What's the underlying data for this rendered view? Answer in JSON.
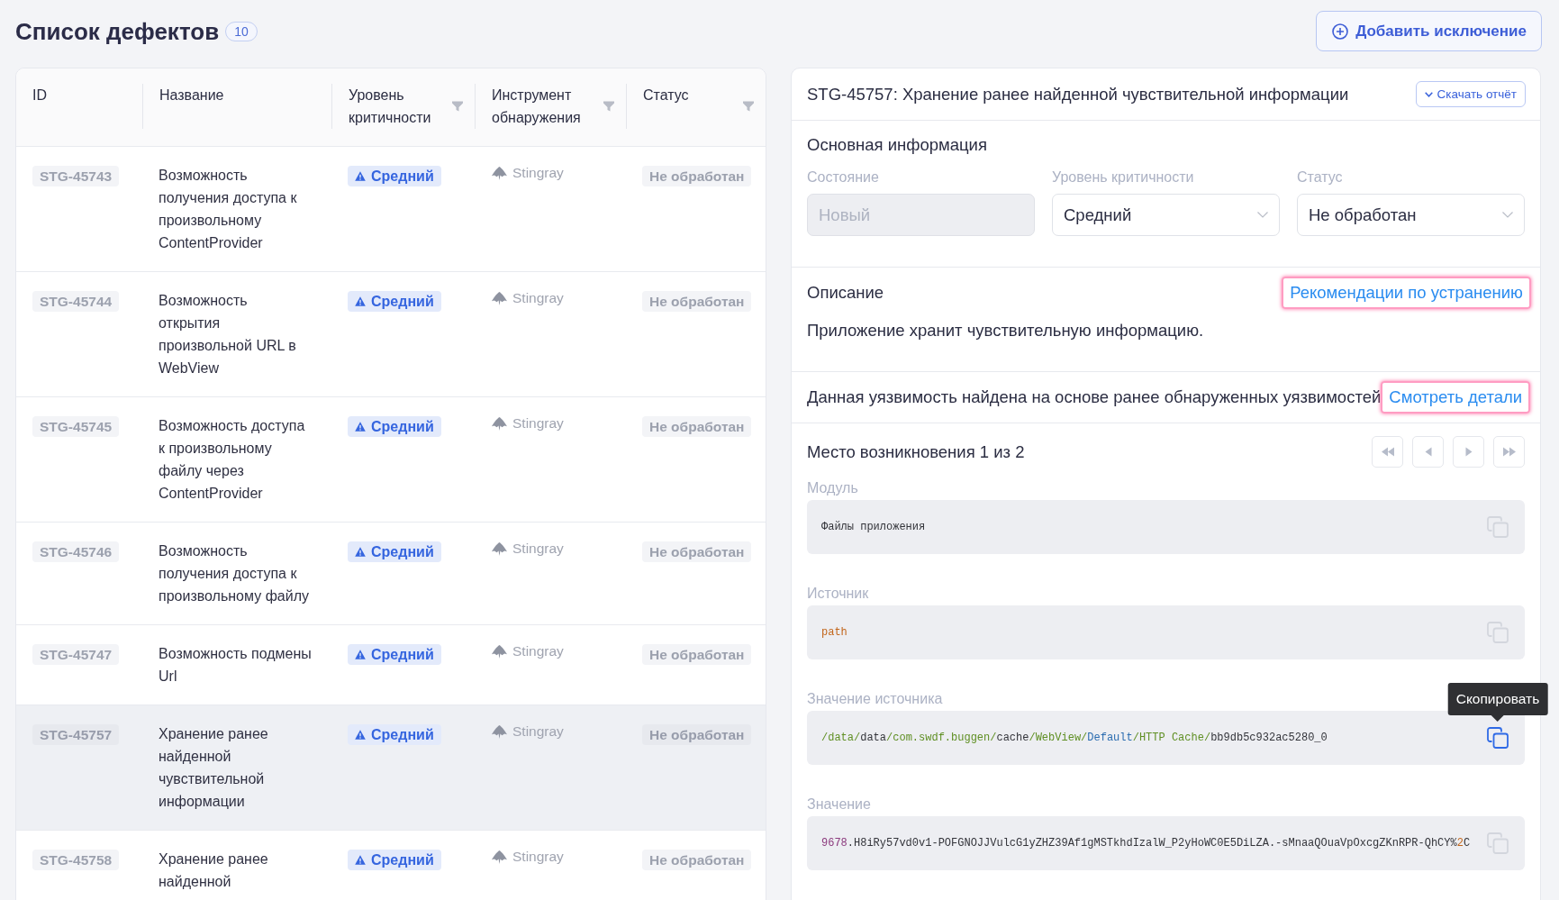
{
  "header": {
    "title": "Список дефектов",
    "count": "10",
    "add_button": "Добавить исключение"
  },
  "table": {
    "columns": [
      {
        "label": "ID",
        "filter": false
      },
      {
        "label": "Название",
        "filter": false
      },
      {
        "label": "Уровень критичности",
        "filter": true
      },
      {
        "label": "Инструмент обнаружения",
        "filter": true
      },
      {
        "label": "Статус",
        "filter": true
      }
    ],
    "rows": [
      {
        "id": "STG-45743",
        "name": "Возможность получения доступа к произвольному ContentProvider",
        "severity": "Средний",
        "tool": "Stingray",
        "status": "Не обработан",
        "selected": false
      },
      {
        "id": "STG-45744",
        "name": "Возможность открытия произвольной URL в WebView",
        "severity": "Средний",
        "tool": "Stingray",
        "status": "Не обработан",
        "selected": false
      },
      {
        "id": "STG-45745",
        "name": "Возможность доступа к произвольному файлу через ContentProvider",
        "severity": "Средний",
        "tool": "Stingray",
        "status": "Не обработан",
        "selected": false
      },
      {
        "id": "STG-45746",
        "name": "Возможность получения доступа к произвольному файлу",
        "severity": "Средний",
        "tool": "Stingray",
        "status": "Не обработан",
        "selected": false
      },
      {
        "id": "STG-45747",
        "name": "Возможность подмены Url",
        "severity": "Средний",
        "tool": "Stingray",
        "status": "Не обработан",
        "selected": false
      },
      {
        "id": "STG-45757",
        "name": "Хранение ранее найденной чувствительной информации",
        "severity": "Средний",
        "tool": "Stingray",
        "status": "Не обработан",
        "selected": true
      },
      {
        "id": "STG-45758",
        "name": "Хранение ранее найденной",
        "severity": "Средний",
        "tool": "Stingray",
        "status": "Не обработан",
        "selected": false
      }
    ]
  },
  "detail": {
    "title": "STG-45757: Хранение ранее найденной чувствительной информации",
    "download_button": "Скачать отчёт",
    "basic": {
      "heading": "Основная информация",
      "fields": [
        {
          "label": "Состояние",
          "value": "Новый",
          "kind": "readonly"
        },
        {
          "label": "Уровень критичности",
          "value": "Средний",
          "kind": "select"
        },
        {
          "label": "Статус",
          "value": "Не обработан",
          "kind": "select"
        }
      ]
    },
    "description": {
      "heading": "Описание",
      "link": {
        "text": "Рекомендации по устранению",
        "highlighted": true
      },
      "text": "Приложение хранит чувствительную информацию."
    },
    "origin_note": {
      "text": "Данная уязвимость найдена на основе ранее обнаруженных уязвимостей",
      "link": {
        "text": "Смотреть детали",
        "highlighted": true
      }
    },
    "location": {
      "heading": "Место возникновения 1 из 2",
      "nav": [
        {
          "kind": "first"
        },
        {
          "kind": "prev"
        },
        {
          "kind": "next"
        },
        {
          "kind": "last"
        }
      ],
      "fields": [
        {
          "label": "Модуль",
          "tokens": [
            {
              "text": "Файлы приложения",
              "kind": "plain"
            }
          ],
          "copy_hovered": false
        },
        {
          "label": "Источник",
          "tokens": [
            {
              "text": "path",
              "kind": "string"
            }
          ],
          "copy_hovered": false
        },
        {
          "label": "Значение источника",
          "tokens": [
            {
              "text": "/data/",
              "kind": "path"
            },
            {
              "text": "data",
              "kind": "plain"
            },
            {
              "text": "/com.swdf.buggen/",
              "kind": "path"
            },
            {
              "text": "cache",
              "kind": "plain"
            },
            {
              "text": "/WebView/",
              "kind": "path"
            },
            {
              "text": "Default",
              "kind": "keyword"
            },
            {
              "text": "/HTTP Cache/",
              "kind": "path"
            },
            {
              "text": "bb9db5c932ac5280_0",
              "kind": "plain"
            }
          ],
          "copy_hovered": true,
          "tooltip": "Скопировать"
        },
        {
          "label": "Значение",
          "tokens": [
            {
              "text": "9678",
              "kind": "number"
            },
            {
              "text": ".H8iRy57vd0v1-POFGNOJJVulcG1yZHZ39Af1gMSTkhdIzalW_P2yHoWC0E5DiLZA.-sMnaaQOuaVpOxcgZKnRPR-QhCY%",
              "kind": "plain"
            },
            {
              "text": "2",
              "kind": "string"
            },
            {
              "text": "C",
              "kind": "plain"
            }
          ],
          "copy_hovered": false
        }
      ]
    }
  }
}
